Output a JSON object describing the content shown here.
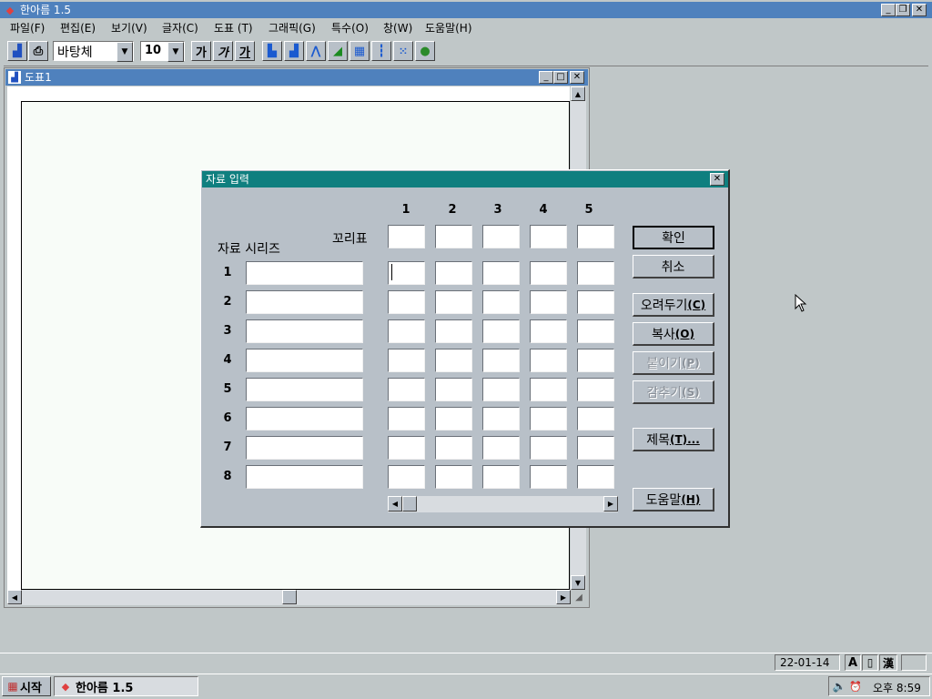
{
  "app": {
    "title": "한아름 1.5",
    "menu": [
      "파일(F)",
      "편집(E)",
      "보기(V)",
      "글자(C)",
      "도표 (T)",
      "그래픽(G)",
      "특수(O)",
      "창(W)",
      "도움말(H)"
    ]
  },
  "toolbar": {
    "font_name": "바탕체",
    "font_size": "10",
    "style_buttons": [
      "가",
      "가",
      "가"
    ],
    "chart_icons": [
      "bar-chart-icon",
      "column-chart-icon",
      "line-chart-icon",
      "area-chart-icon",
      "stacked-bar-icon",
      "hilo-chart-icon",
      "scatter-chart-icon",
      "pie-chart-icon"
    ]
  },
  "doc_window": {
    "title": "도표1"
  },
  "dialog": {
    "title": "자료 입력",
    "legend_label": "꼬리표",
    "series_label": "자료 시리즈",
    "columns": [
      "1",
      "2",
      "3",
      "4",
      "5"
    ],
    "rows": [
      "1",
      "2",
      "3",
      "4",
      "5",
      "6",
      "7",
      "8"
    ],
    "buttons": {
      "ok": "확인",
      "cancel": "취소",
      "cut": "오려두기",
      "cut_key": "(C)",
      "copy": "복사",
      "copy_key": "(O)",
      "paste": "붙이기",
      "paste_key": "(P)",
      "hide": "감추기",
      "hide_key": "(S)",
      "titles": "제목",
      "titles_key": "(T)...",
      "help": "도움말",
      "help_key": "(H)"
    }
  },
  "statusbar": {
    "date": "22-01-14"
  },
  "taskbar": {
    "start": "시작",
    "task": "한아름 1.5",
    "clock": "오후 8:59"
  },
  "colors": {
    "title_bar": "#4f81bd",
    "dialog_title": "#0f7f7f",
    "desktop": "#c0c7c8"
  }
}
